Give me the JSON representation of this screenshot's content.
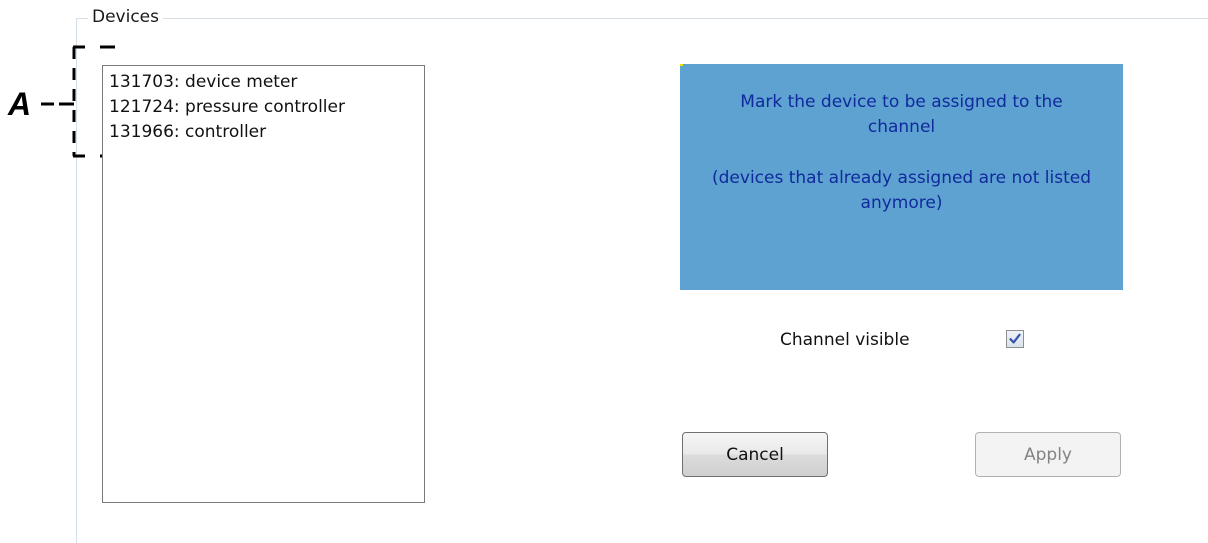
{
  "groupbox": {
    "title": "Devices"
  },
  "annotation": {
    "label": "A"
  },
  "device_list": {
    "items": [
      {
        "label": "131703: device meter"
      },
      {
        "label": "121724: pressure controller"
      },
      {
        "label": "131966: controller"
      }
    ]
  },
  "info_panel": {
    "line1": "Mark the device  to be assigned to the channel",
    "line2": "(devices that already assigned are not listed anymore)",
    "background_color": "#5ea2d2",
    "text_color": "#102a9c"
  },
  "channel_visible": {
    "label": "Channel visible",
    "checked": true
  },
  "buttons": {
    "cancel_label": "Cancel",
    "apply_label": "Apply",
    "apply_enabled": false
  }
}
